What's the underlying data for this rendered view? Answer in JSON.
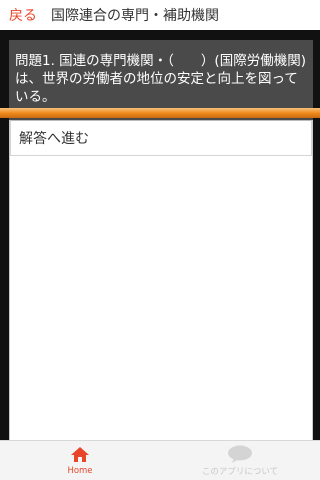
{
  "header": {
    "back_label": "戻る",
    "title": "国際連合の専門・補助機関"
  },
  "question": {
    "text": "問題1. 国連の専門機関・（　　）(国際労働機関)は、世界の労働者の地位の安定と向上を図っている。"
  },
  "answer": {
    "label": "解答へ進む"
  },
  "tabbar": {
    "tabs": [
      {
        "label": "Home",
        "icon": "home-icon",
        "active": true
      },
      {
        "label": "このアプリについて",
        "icon": "chat-bubble-icon",
        "active": false
      }
    ]
  },
  "colors": {
    "accent": "#e8462a",
    "orange_bar": "#f08a1c",
    "question_bg": "#4a4a4a",
    "frame_bg": "#111111"
  }
}
